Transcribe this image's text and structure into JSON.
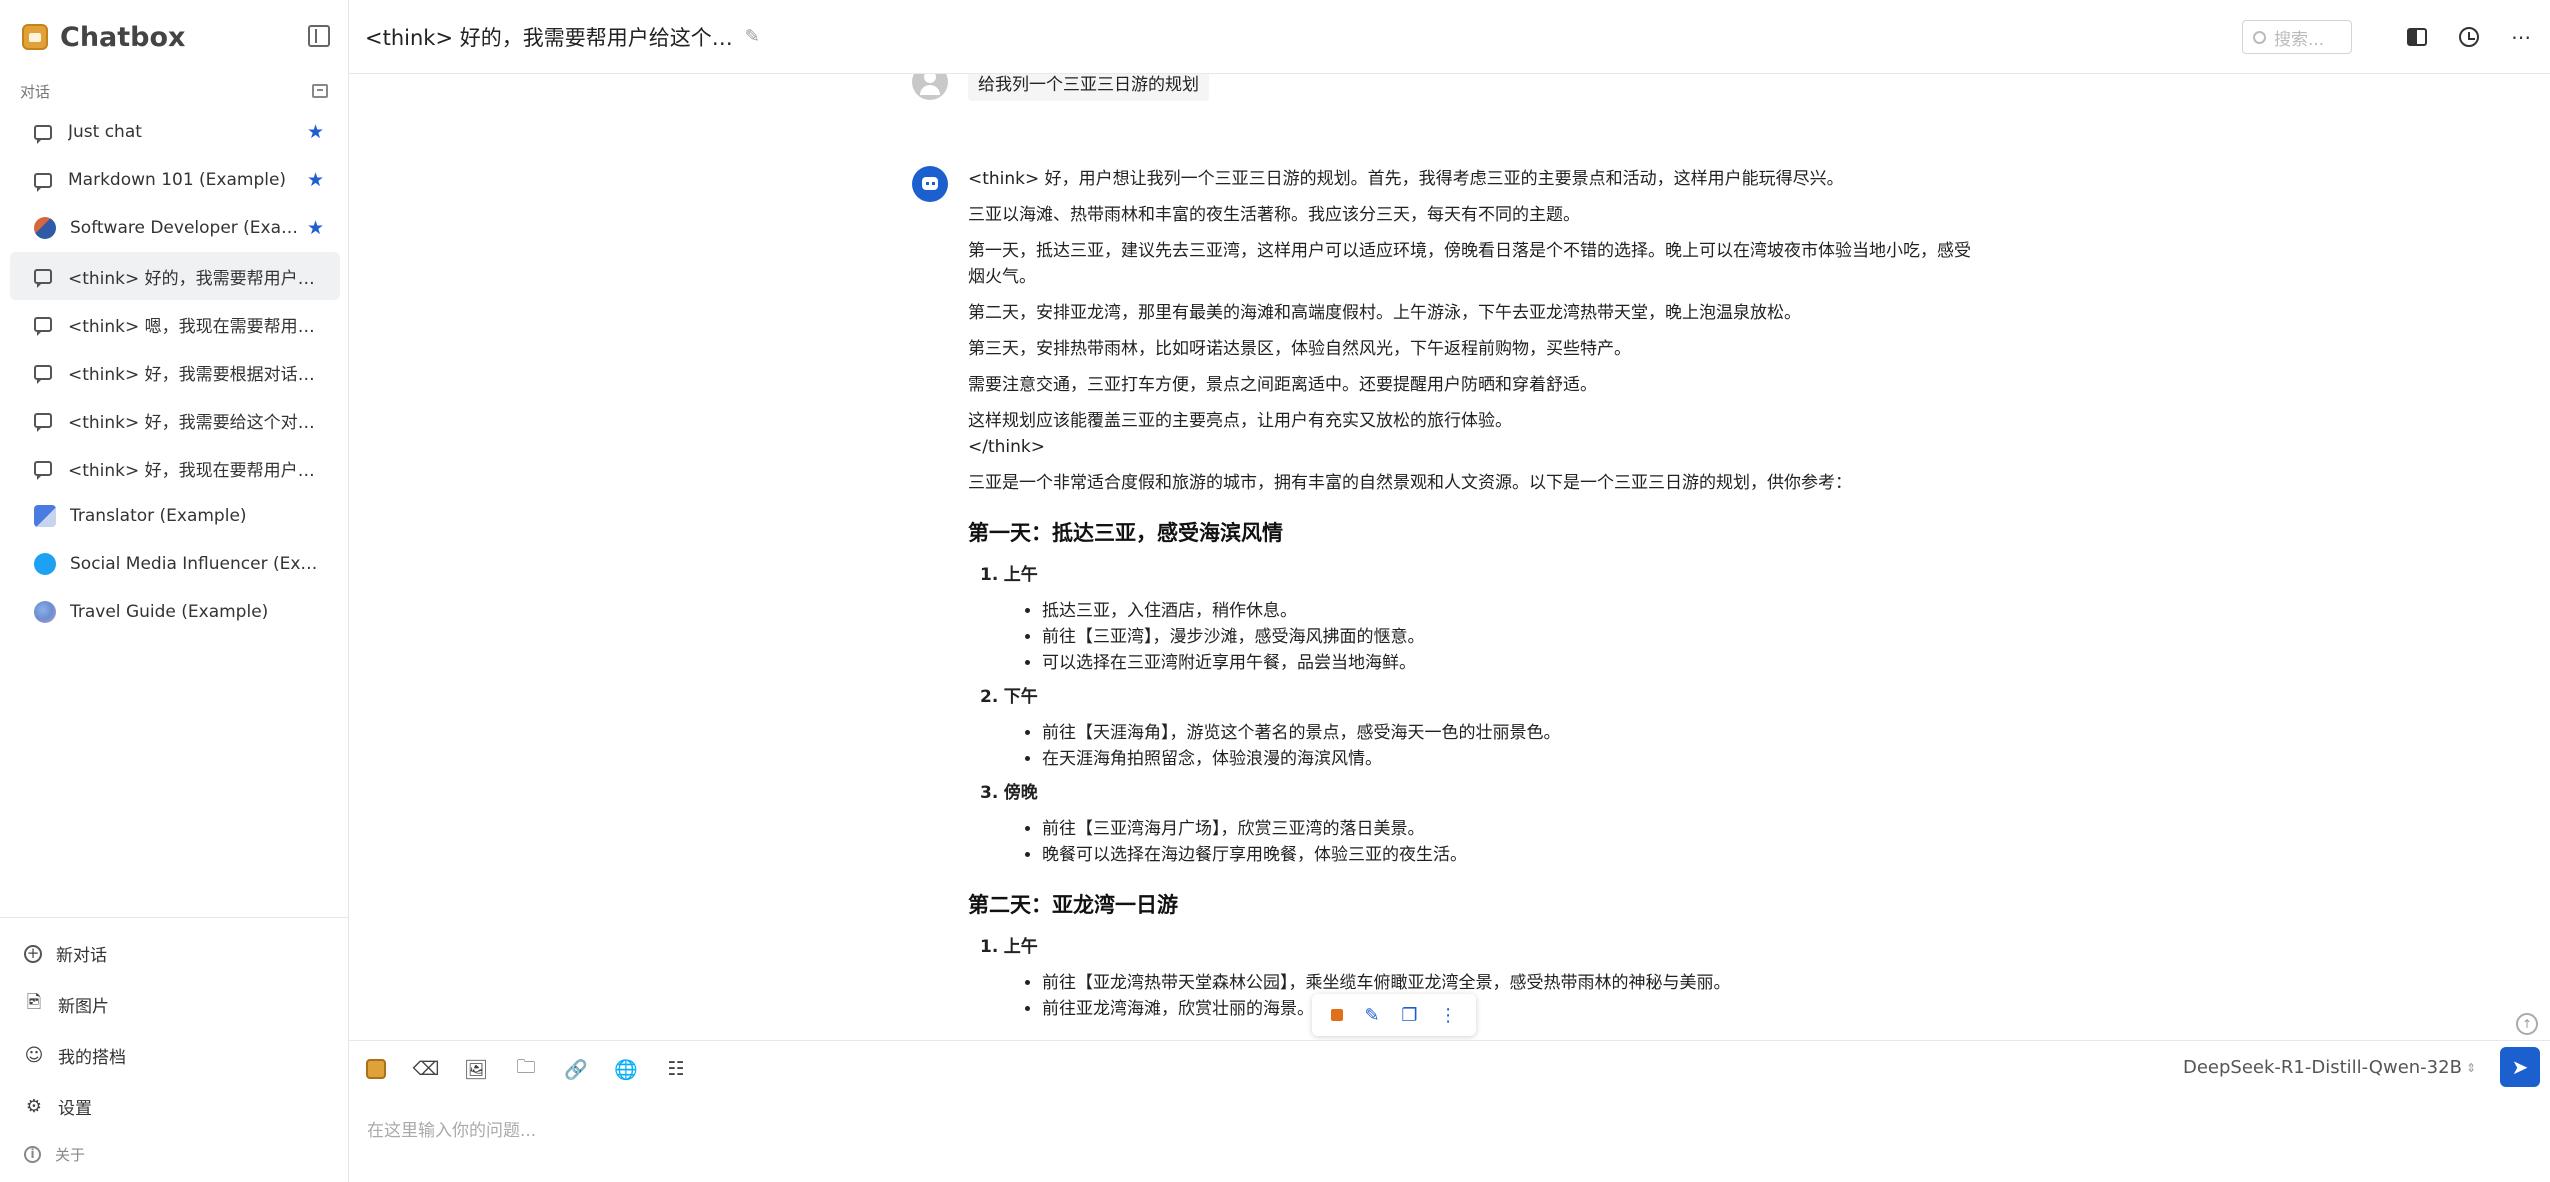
{
  "app": {
    "name": "Chatbox"
  },
  "sidebar": {
    "section_label": "对话",
    "items": [
      {
        "label": "Just chat",
        "icon": "chat-icon",
        "starred": true,
        "selected": false
      },
      {
        "label": "Markdown 101 (Example)",
        "icon": "chat-icon",
        "starred": true,
        "selected": false
      },
      {
        "label": "Software Developer (Example)",
        "icon": "developer-avatar",
        "starred": true,
        "selected": false
      },
      {
        "label": "<think> 好的，我需要帮用户给这个对话起一个标题",
        "icon": "chat-icon",
        "starred": false,
        "selected": true
      },
      {
        "label": "<think> 嗯，我现在需要帮用户给这个对话起标题",
        "icon": "chat-icon",
        "starred": false,
        "selected": false
      },
      {
        "label": "<think> 好，我需要根据对话内容起一个标题",
        "icon": "chat-icon",
        "starred": false,
        "selected": false
      },
      {
        "label": "<think> 好，我需要给这个对话起一个标题",
        "icon": "chat-icon",
        "starred": false,
        "selected": false
      },
      {
        "label": "<think> 好，我现在要帮用户给一个对话起标题",
        "icon": "chat-icon",
        "starred": false,
        "selected": false
      },
      {
        "label": "Translator (Example)",
        "icon": "translator-avatar",
        "starred": false,
        "selected": false
      },
      {
        "label": "Social Media Influencer (Example)",
        "icon": "twitter-avatar",
        "starred": false,
        "selected": false
      },
      {
        "label": "Travel Guide (Example)",
        "icon": "travel-avatar",
        "starred": false,
        "selected": false
      }
    ],
    "bottom": {
      "new_chat": "新对话",
      "new_image": "新图片",
      "my_partners": "我的搭档",
      "settings": "设置",
      "about": "关于"
    }
  },
  "header": {
    "title": "<think> 好的，我需要帮用户给这个…",
    "search_placeholder": "搜索..."
  },
  "chat": {
    "user_message": "给我列一个三亚三日游的规划",
    "bot": {
      "think": [
        "<think> 好，用户想让我列一个三亚三日游的规划。首先，我得考虑三亚的主要景点和活动，这样用户能玩得尽兴。",
        "三亚以海滩、热带雨林和丰富的夜生活著称。我应该分三天，每天有不同的主题。",
        "第一天，抵达三亚，建议先去三亚湾，这样用户可以适应环境，傍晚看日落是个不错的选择。晚上可以在湾坡夜市体验当地小吃，感受烟火气。",
        "第二天，安排亚龙湾，那里有最美的海滩和高端度假村。上午游泳，下午去亚龙湾热带天堂，晚上泡温泉放松。",
        "第三天，安排热带雨林，比如呀诺达景区，体验自然风光，下午返程前购物，买些特产。",
        "需要注意交通，三亚打车方便，景点之间距离适中。还要提醒用户防晒和穿着舒适。"
      ],
      "think_last": "这样规划应该能覆盖三亚的主要亮点，让用户有充实又放松的旅行体验。",
      "think_close": "</think>",
      "intro": "三亚是一个非常适合度假和旅游的城市，拥有丰富的自然景观和人文资源。以下是一个三亚三日游的规划，供你参考：",
      "day1": {
        "heading": "第一天：抵达三亚，感受海滨风情",
        "morning": {
          "num": "1.",
          "label": "上午",
          "items": [
            "抵达三亚，入住酒店，稍作休息。",
            "前往【三亚湾】，漫步沙滩，感受海风拂面的惬意。",
            "可以选择在三亚湾附近享用午餐，品尝当地海鲜。"
          ]
        },
        "afternoon": {
          "num": "2.",
          "label": "下午",
          "items": [
            "前往【天涯海角】，游览这个著名的景点，感受海天一色的壮丽景色。",
            "在天涯海角拍照留念，体验浪漫的海滨风情。"
          ]
        },
        "evening": {
          "num": "3.",
          "label": "傍晚",
          "items": [
            "前往【三亚湾海月广场】，欣赏三亚湾的落日美景。",
            "晚餐可以选择在海边餐厅享用晚餐，体验三亚的夜生活。"
          ]
        }
      },
      "day2": {
        "heading": "第二天：亚龙湾一日游",
        "morning": {
          "num": "1.",
          "label": "上午",
          "items": [
            "前往【亚龙湾热带天堂森林公园】，乘坐缆车俯瞰亚龙湾全景，感受热带雨林的神秘与美丽。",
            "前往亚龙湾海滩，欣赏壮丽的海景。"
          ]
        }
      }
    }
  },
  "composer": {
    "placeholder": "在这里输入你的问题...",
    "model": "DeepSeek-R1-Distill-Qwen-32B"
  },
  "colors": {
    "accent": "#1c5fcf",
    "brand": "#e0a238",
    "stop": "#e06f1a"
  }
}
